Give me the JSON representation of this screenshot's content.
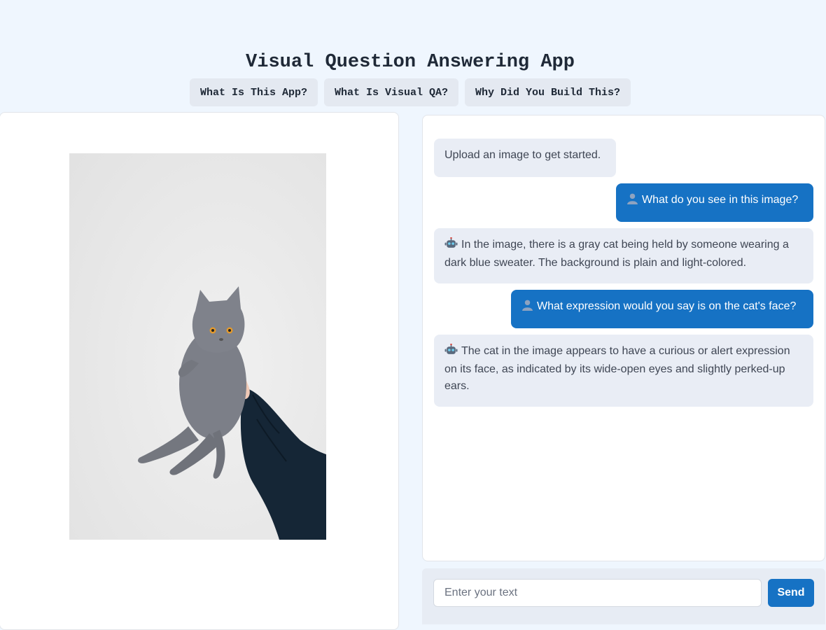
{
  "app": {
    "title": "Visual Question Answering App"
  },
  "nav": {
    "items": [
      {
        "label": "What Is This App?"
      },
      {
        "label": "What Is Visual QA?"
      },
      {
        "label": "Why Did You Build This?"
      }
    ]
  },
  "image_panel": {
    "image_icon": "cat-photo"
  },
  "chat": {
    "messages": [
      {
        "role": "bot",
        "text": "Upload an image to get started.",
        "icon": "none"
      },
      {
        "role": "user",
        "text": "What do you see in this image?",
        "icon": "user-icon"
      },
      {
        "role": "bot",
        "text": "In the image, there is a gray cat being held by someone wearing a dark blue sweater. The background is plain and light-colored.",
        "icon": "robot-icon"
      },
      {
        "role": "user",
        "text": "What expression would you say is on the cat's face?",
        "icon": "user-icon"
      },
      {
        "role": "bot",
        "text": "The cat in the image appears to have a curious or alert expression on its face, as indicated by its wide-open eyes and slightly perked-up ears.",
        "icon": "robot-icon"
      }
    ]
  },
  "input": {
    "placeholder": "Enter your text",
    "value": "",
    "send_label": "Send"
  },
  "colors": {
    "background": "#eff6fe",
    "accent": "#1672c4",
    "bot_bubble": "#e9edf5"
  }
}
